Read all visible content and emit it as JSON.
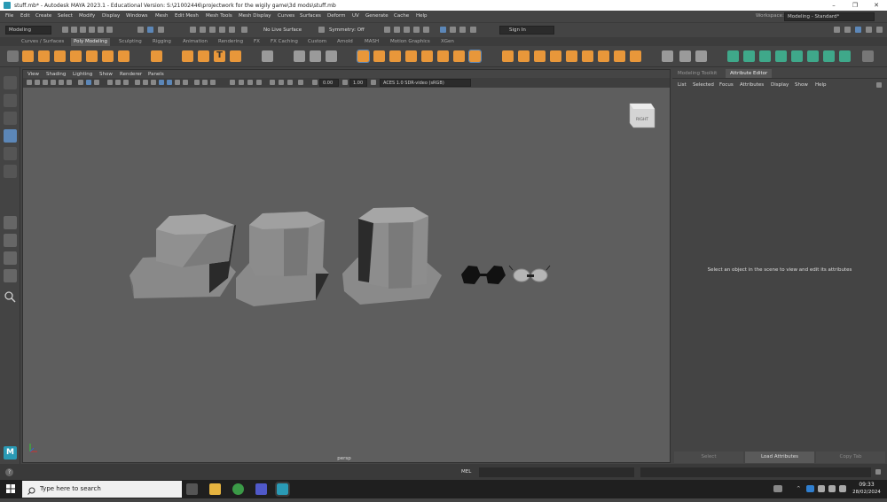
{
  "window": {
    "title": "stuff.mb* - Autodesk MAYA 2023.1 - Educational Version: S:\\21002446\\projectwork for the wigily game\\3d mods\\stuff.mb",
    "minimize": "–",
    "maximize": "❐",
    "close": "✕"
  },
  "menubar": {
    "items": [
      "File",
      "Edit",
      "Create",
      "Select",
      "Modify",
      "Display",
      "Windows",
      "Mesh",
      "Edit Mesh",
      "Mesh Tools",
      "Mesh Display",
      "Curves",
      "Surfaces",
      "Deform",
      "UV",
      "Generate",
      "Cache",
      "Help"
    ],
    "workspace_label": "Workspace:",
    "workspace_value": "Modeling - Standard*"
  },
  "statusline": {
    "mode": "Modeling",
    "live_surface": "No Live Surface",
    "symmetry": "Symmetry: Off",
    "sign_in": "Sign In"
  },
  "shelf_tabs": [
    "Curves / Surfaces",
    "Poly Modeling",
    "Sculpting",
    "Rigging",
    "Animation",
    "Rendering",
    "FX",
    "FX Caching",
    "Custom",
    "Arnold",
    "MASH",
    "Motion Graphics",
    "XGen"
  ],
  "active_shelf_tab": "Poly Modeling",
  "panel_menu": [
    "View",
    "Shading",
    "Lighting",
    "Show",
    "Renderer",
    "Panels"
  ],
  "viewport": {
    "exposure": "0.00",
    "gamma": "1.00",
    "color_space": "ACES 1.0 SDR-video (sRGB)",
    "camera_label": "persp",
    "viewcube_label": "RIGHT"
  },
  "right_panel": {
    "tabs": [
      "Modeling Toolkit",
      "Attribute Editor"
    ],
    "active_tab": "Attribute Editor",
    "menu": [
      "List",
      "Selected",
      "Focus",
      "Attributes",
      "Display",
      "Show",
      "Help"
    ],
    "message": "Select an object in the scene to view and edit its attributes",
    "buttons": [
      "Select",
      "Load Attributes",
      "Copy Tab"
    ]
  },
  "command_line": {
    "label": "MEL",
    "help_icon": "?"
  },
  "taskbar": {
    "search_placeholder": "Type here to search",
    "time": "09:33",
    "date": "28/02/2024"
  },
  "colors": {
    "shelf_orange": "#e8973a",
    "highlight_blue": "#5c87b8",
    "viewport_bg": "#5e5e5e",
    "mesh_grey": "#8a8a8a"
  }
}
